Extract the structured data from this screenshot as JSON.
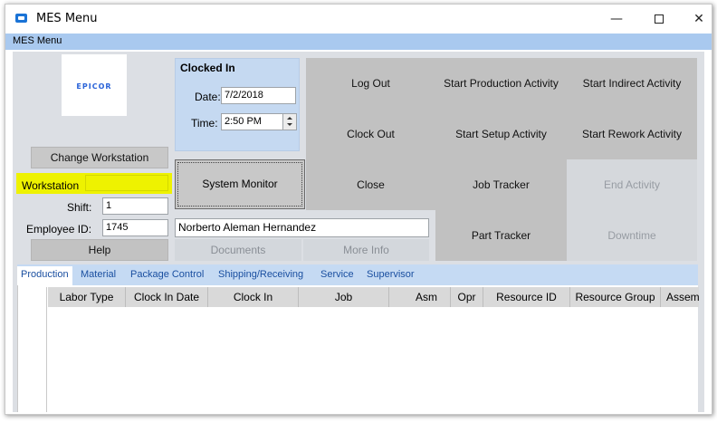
{
  "window": {
    "title": "MES Menu",
    "minimize": "—",
    "close": "✕"
  },
  "menubar": {
    "label": "MES Menu"
  },
  "logo": {
    "text": "EPICOR"
  },
  "left_panel": {
    "change_workstation": "Change Workstation",
    "workstation_label": "Workstation",
    "workstation_value": "",
    "shift_label": "Shift:",
    "shift_value": "1",
    "employee_label": "Employee ID:",
    "employee_value": "1745",
    "help": "Help"
  },
  "clocked_in": {
    "title": "Clocked In",
    "date_label": "Date:",
    "date_value": "7/2/2018",
    "time_label": "Time:",
    "time_value": "2:50 PM"
  },
  "employee_name": "Norberto Aleman Hernandez",
  "documents": "Documents",
  "more_info": "More Info",
  "system_monitor": "System Monitor",
  "actions": {
    "log_out": "Log Out",
    "clock_out": "Clock Out",
    "close": "Close",
    "start_production": "Start Production Activity",
    "start_setup": "Start Setup Activity",
    "job_tracker": "Job Tracker",
    "part_tracker": "Part Tracker",
    "start_indirect": "Start Indirect Activity",
    "start_rework": "Start Rework Activity",
    "end_activity": "End Activity",
    "downtime": "Downtime"
  },
  "tabs": [
    "Production",
    "Material",
    "Package Control",
    "Shipping/Receiving",
    "Service",
    "Supervisor"
  ],
  "grid_columns": [
    "Labor Type",
    "Clock In Date",
    "Clock In",
    "Job",
    "Asm",
    "Opr",
    "Resource ID",
    "Resource Group",
    "Assem"
  ],
  "colors": {
    "highlight": "#eef200",
    "menubar": "#a9c9ef",
    "panel_blue": "#c5d9f1",
    "tab_text": "#1a4fa0"
  }
}
